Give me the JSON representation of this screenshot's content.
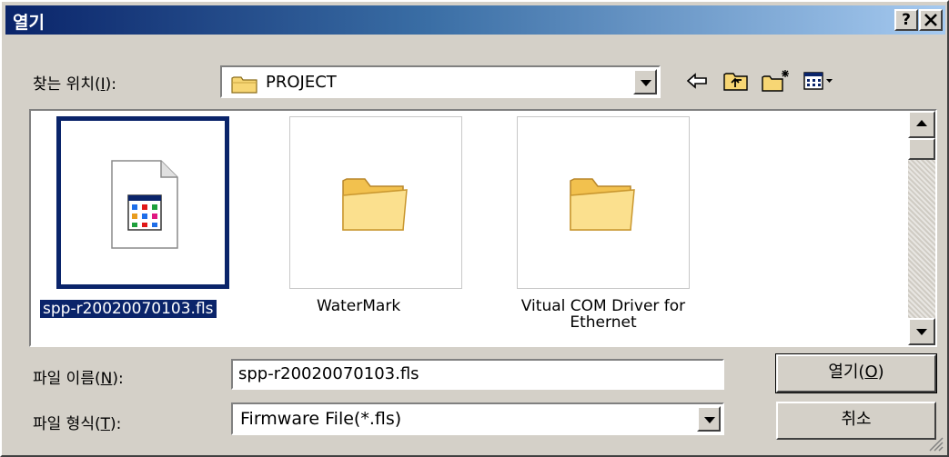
{
  "dialog": {
    "title": "열기",
    "help_button": "?",
    "close_button": "X"
  },
  "lookin": {
    "label": "찾는 위치(",
    "label_key": "I",
    "label_end": "):",
    "value": "PROJECT"
  },
  "toolbar": {
    "back_icon": "back-arrow-icon",
    "up_icon": "up-folder-icon",
    "new_folder_icon": "new-folder-icon",
    "view_menu_icon": "view-menu-icon"
  },
  "files": [
    {
      "name": "spp-r20020070103.fls",
      "type": "file",
      "selected": true
    },
    {
      "name": "WaterMark",
      "type": "folder",
      "selected": false
    },
    {
      "name": "Vitual COM Driver for",
      "name2": "Ethernet",
      "type": "folder",
      "selected": false
    }
  ],
  "filename": {
    "label": "파일 이름(",
    "label_key": "N",
    "label_end": "):",
    "value": "spp-r20020070103.fls"
  },
  "filetype": {
    "label": "파일 형식(",
    "label_key": "T",
    "label_end": "):",
    "value": "Firmware File(*.fls)"
  },
  "buttons": {
    "open": "열기(",
    "open_key": "O",
    "open_end": ")",
    "cancel": "취소"
  },
  "colors": {
    "titlebar_start": "#0a246a",
    "titlebar_end": "#a6caf0",
    "face": "#d4d0c8",
    "selection": "#0a246a"
  }
}
